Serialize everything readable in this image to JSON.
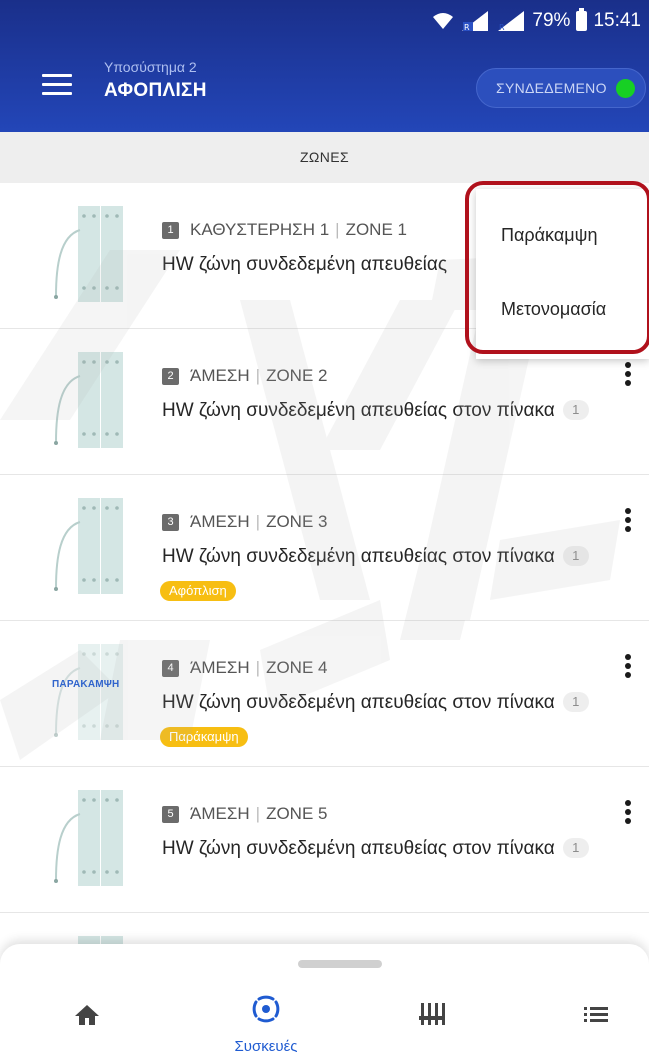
{
  "status_bar": {
    "battery_percent": "79%",
    "time": "15:41"
  },
  "header": {
    "subsystem": "Υποσύστημα 2",
    "arm_state": "ΑΦΟΠΛΙΣΗ",
    "connection_label": "ΣΥΝΔΕΔΕΜΕΝΟ",
    "connection_color": "#17d024",
    "bar_color": "#2346b8"
  },
  "tab_title": "ΖΩΝΕΣ",
  "zones": [
    {
      "number": "1",
      "type": "ΚΑΘΥΣΤΕΡΗΣΗ 1",
      "name": "ZONE 1",
      "description": "HW ζώνη συνδεδεμένη απευθείας",
      "count": "",
      "badge": "",
      "image_label": ""
    },
    {
      "number": "2",
      "type": "ΆΜΕΣΗ",
      "name": "ZONE 2",
      "description": "HW ζώνη συνδεδεμένη απευθείας στον πίνακα",
      "count": "1",
      "badge": "",
      "image_label": ""
    },
    {
      "number": "3",
      "type": "ΆΜΕΣΗ",
      "name": "ZONE 3",
      "description": "HW ζώνη συνδεδεμένη απευθείας στον πίνακα",
      "count": "1",
      "badge": "Αφόπλιση",
      "image_label": ""
    },
    {
      "number": "4",
      "type": "ΆΜΕΣΗ",
      "name": "ZONE 4",
      "description": "HW ζώνη συνδεδεμένη απευθείας στον πίνακα",
      "count": "1",
      "badge": "Παράκαμψη",
      "image_label": "ΠΑΡΑΚΑΜΨΗ"
    },
    {
      "number": "5",
      "type": "ΆΜΕΣΗ",
      "name": "ZONE 5",
      "description": "HW ζώνη συνδεδεμένη απευθείας στον πίνακα",
      "count": "1",
      "badge": "",
      "image_label": ""
    }
  ],
  "popup_menu": {
    "items": [
      "Παράκαμψη",
      "Μετονομασία"
    ],
    "highlight_color": "#b0111c"
  },
  "bottom_nav": {
    "active_label": "Συσκευές",
    "items": [
      "home-icon",
      "devices-icon",
      "controls-icon",
      "list-icon"
    ],
    "active_color": "#1f5bd1",
    "badge_color": "#f7be12"
  }
}
